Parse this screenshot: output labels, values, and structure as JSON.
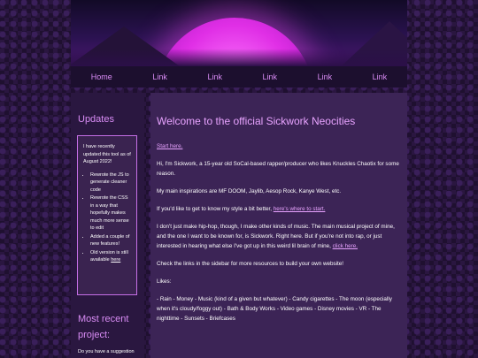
{
  "nav": [
    "Home",
    "Link",
    "Link",
    "Link",
    "Link",
    "Link"
  ],
  "sidebar": {
    "updates_title": "Updates",
    "updates_intro": "I have recently updated this tool as of August 2022!",
    "updates_items": [
      "Rewrote the JS to generate cleaner code",
      "Rewrote the CSS in a way that hopefully makes much more sense to edit",
      "Added a couple of new features!"
    ],
    "old_version_text": "Old version is still available ",
    "old_version_link": "here",
    "recent_title": "Most recent project:",
    "suggestion": "Do you have a suggestion"
  },
  "main": {
    "title": "Welcome to the official Sickwork Neocities",
    "start": "Start here.",
    "intro": "Hi, I'm Sickwork, a 15-year old SoCal-based rapper/producer who likes Knuckles Chaotix for some reason.",
    "inspirations": "My main inspirations are MF DOOM, Jaylib, Aesop Rock, Kanye West, etc.",
    "style_text": "If you'd like to get to know my style a bit better, ",
    "style_link": "here's where to start.",
    "music_text": "I don't just make hip-hop, though, I make other kinds of music. The main musical project of mine, and the one I want to be known for, is Sickwork. Right here. But if you're not into rap, or just interested in hearing what else I've got up in this weird lil brain of mine, ",
    "music_link": "click here.",
    "links_text": "Check the links in the sidebar for more resources to build your own website!",
    "likes_label": "Likes:",
    "likes": "- Rain - Money - Music (kind of a given but whatever) - Candy cigarettes - The moon (especially when it's cloudy/foggy out) - Bath & Body Works - Video games - Disney movies - VR - The nighttime - Sunsets - Briefcases"
  },
  "colors": {
    "accent": "#e8a3ff",
    "nav_link": "#d98cf5",
    "panel": "#3c2456",
    "sidebar": "#2a1740"
  }
}
